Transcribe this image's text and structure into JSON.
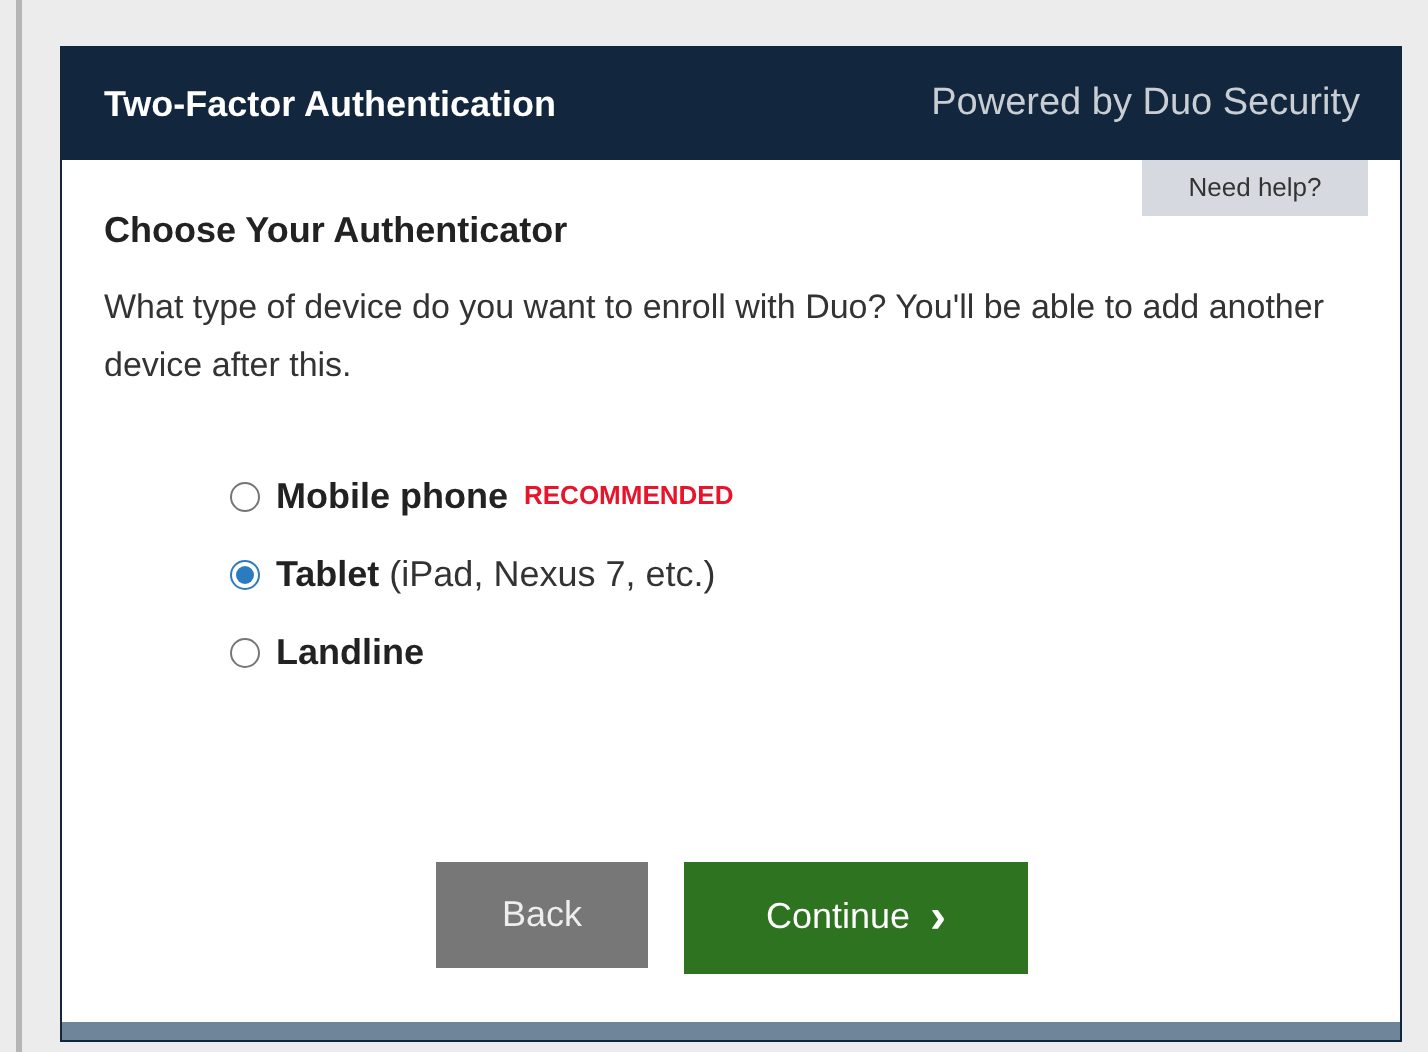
{
  "header": {
    "title": "Two-Factor Authentication",
    "powered_by": "Powered by Duo Security"
  },
  "help_button": "Need help?",
  "heading": "Choose Your Authenticator",
  "description": "What type of device do you want to enroll with Duo? You'll be able to add another device after this.",
  "options": [
    {
      "label": "Mobile phone",
      "badge": "RECOMMENDED",
      "selected": false
    },
    {
      "label": "Tablet",
      "detail": "(iPad, Nexus 7, etc.)",
      "selected": true
    },
    {
      "label": "Landline",
      "selected": false
    }
  ],
  "buttons": [
    {
      "kind": "back",
      "label": "Back"
    },
    {
      "kind": "continue",
      "label": "Continue",
      "icon": "›"
    }
  ]
}
